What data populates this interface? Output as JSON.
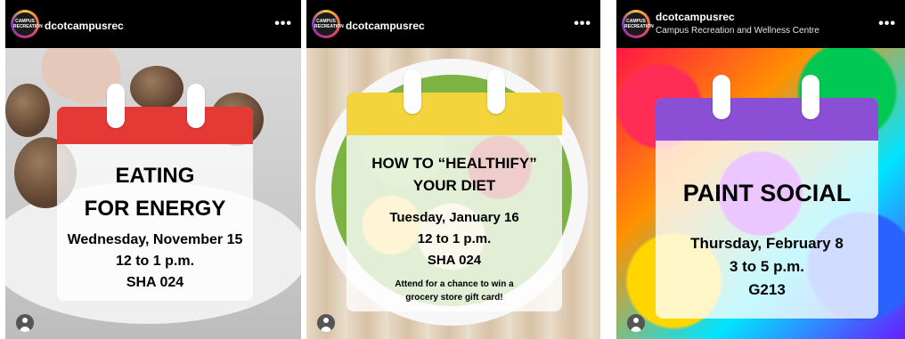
{
  "posts": [
    {
      "username": "dcotcampusrec",
      "subtitle": "",
      "avatar_text": [
        "CAMPUS",
        "RECREATION"
      ],
      "card": {
        "title_lines": [
          "EATING",
          "FOR ENERGY"
        ],
        "details": [
          "Wednesday, November 15",
          "12 to 1 p.m.",
          "SHA 024"
        ],
        "note": [],
        "accent": "#e53935"
      }
    },
    {
      "username": "dcotcampusrec",
      "subtitle": "",
      "avatar_text": [
        "CAMPUS",
        "RECREATION"
      ],
      "card": {
        "title_lines": [
          "HOW TO “HEALTHIFY”",
          "YOUR DIET"
        ],
        "details": [
          "Tuesday, January 16",
          "12 to 1 p.m.",
          "SHA 024"
        ],
        "note": [
          "Attend for a chance to win a",
          "grocery store gift card!"
        ],
        "accent": "#f3d43c"
      }
    },
    {
      "username": "dcotcampusrec",
      "subtitle": "Campus Recreation and Wellness Centre",
      "avatar_text": [
        "CAMPUS",
        "RECREATION"
      ],
      "card": {
        "title_lines": [
          "PAINT SOCIAL"
        ],
        "details": [
          "Thursday, February 8",
          "3 to 5 p.m.",
          "G213"
        ],
        "note": [],
        "accent": "#8b4fd6"
      }
    }
  ],
  "icons": {
    "more": "more-options-icon",
    "profile": "user-profile-icon"
  }
}
